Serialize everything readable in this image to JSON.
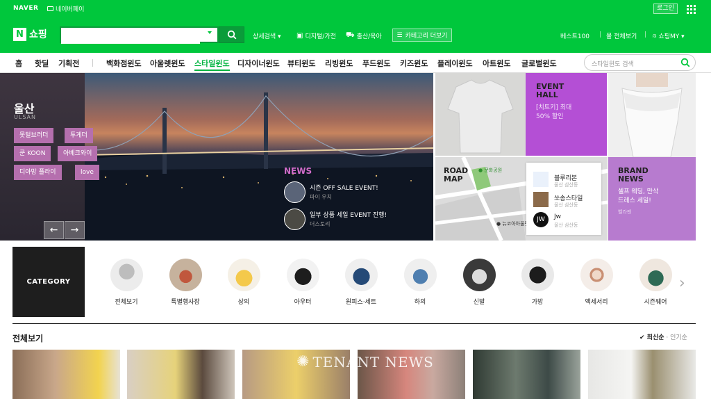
{
  "topbar": {
    "naver": "NAVER",
    "pay": "네이버페이",
    "login": "로그인"
  },
  "header": {
    "shop": "쇼핑",
    "search_placeholder": "",
    "detail_search": "상세검색 ▾",
    "digital": "디지털/가전",
    "baby": "출산/육아",
    "category_more": "카테고리 더보기",
    "best100": "베스트100",
    "mall_all": "몰 전체보기",
    "my_shop": "쇼핑MY ▾"
  },
  "nav": {
    "items": [
      "홈",
      "핫딜",
      "기획전",
      "백화점윈도",
      "아울렛윈도",
      "스타일윈도",
      "디자이너윈도",
      "뷰티윈도",
      "리빙윈도",
      "푸드윈도",
      "키즈윈도",
      "플레이윈도",
      "아트윈도",
      "글로벌윈도"
    ],
    "active": "스타일윈도",
    "search_placeholder": "스타일윈도 검색"
  },
  "hero": {
    "city": "울산",
    "city_en": "ULSAN",
    "tags": [
      "못털브러더",
      "투게더",
      "쿤 KOON",
      "아베크와이",
      "디아망 플라이",
      "love"
    ],
    "news_title": "NEWS",
    "news": [
      {
        "title": "시즌 OFF SALE EVENT!",
        "sub": "파이 우치"
      },
      {
        "title": "일부 상품 세일 EVENT 진행!",
        "sub": "더스토리"
      }
    ],
    "prev": "←",
    "next": "→"
  },
  "tiles": {
    "event_hall": {
      "title1": "EVENT",
      "title2": "HALL",
      "desc1": "[치트키] 최대",
      "desc2": "50% 할인"
    },
    "road_map": {
      "title1": "ROAD",
      "title2": "MAP",
      "park": "● 문화공원",
      "bottom": "● 뉴코아아울렛"
    },
    "shops": [
      "블루리본",
      "쏘송스타일",
      "Jw"
    ],
    "shop_subs": [
      "울산 삼산동",
      "울산 삼산동",
      "울산 삼산동"
    ],
    "brand_news": {
      "title1": "BRAND",
      "title2": "NEWS",
      "desc1": "셀프 웨딩, 만삭",
      "desc2": "드레스 세일!",
      "sub": "벨라젠"
    }
  },
  "category": {
    "label": "CATEGORY",
    "items": [
      "전체보기",
      "특별행사장",
      "상의",
      "아우터",
      "원피스·세트",
      "하의",
      "신발",
      "가방",
      "액세서리",
      "시즌웨어"
    ]
  },
  "section": {
    "title": "전체보기",
    "sort_on": "✔ 최신순",
    "sort_off": "인기순",
    "sort_sep": " · "
  },
  "watermark": "TENANT NEWS",
  "colors": {
    "naver_green": "#00c73c",
    "active_nav": "#00b43f",
    "tag_purple": "#b56fae",
    "news_pink": "#d06cc9",
    "event_purple": "#b44fd5",
    "brand_purple": "#b77bcf"
  }
}
